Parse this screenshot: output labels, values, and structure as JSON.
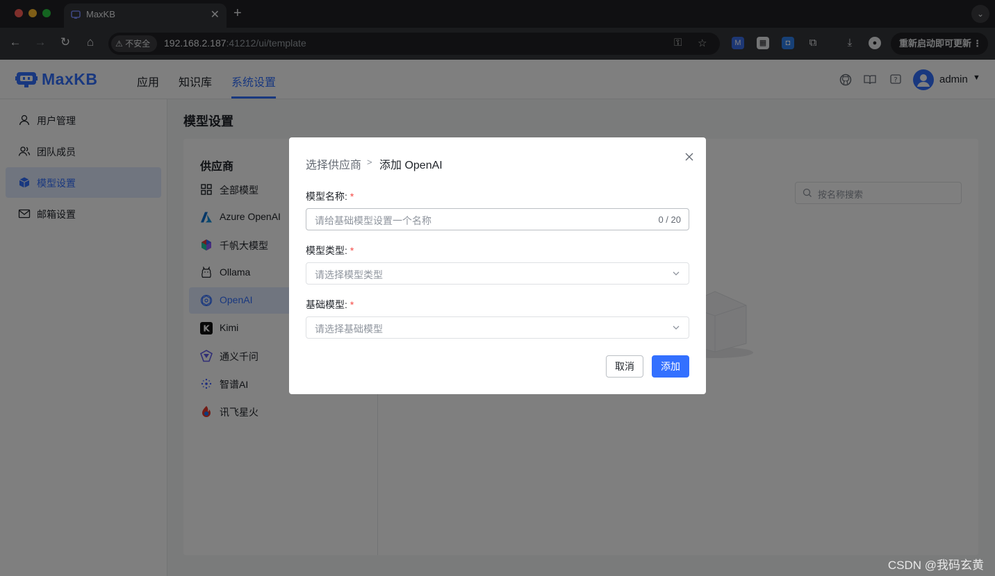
{
  "browser": {
    "tab_title": "MaxKB",
    "new_tab": "+",
    "insecure_label": "不安全",
    "url_host": "192.168.2.187",
    "url_rest": ":41212/ui/template",
    "update_label": "重新启动即可更新"
  },
  "app": {
    "logo_text": "MaxKB",
    "nav": [
      "应用",
      "知识库",
      "系统设置"
    ],
    "user": "admin"
  },
  "sidebar": {
    "items": [
      {
        "label": "用户管理",
        "icon": "user-icon"
      },
      {
        "label": "团队成员",
        "icon": "team-icon"
      },
      {
        "label": "模型设置",
        "icon": "cube-icon",
        "active": true
      },
      {
        "label": "邮箱设置",
        "icon": "mail-icon"
      }
    ]
  },
  "main": {
    "page_title": "模型设置",
    "provider_title": "供应商",
    "providers": [
      {
        "label": "全部模型",
        "icon": "grid-icon"
      },
      {
        "label": "Azure OpenAI",
        "icon": "azure-icon"
      },
      {
        "label": "千帆大模型",
        "icon": "qianfan-icon"
      },
      {
        "label": "Ollama",
        "icon": "ollama-icon"
      },
      {
        "label": "OpenAI",
        "icon": "openai-icon",
        "active": true
      },
      {
        "label": "Kimi",
        "icon": "kimi-icon"
      },
      {
        "label": "通义千问",
        "icon": "tongyi-icon"
      },
      {
        "label": "智谱AI",
        "icon": "zhipu-icon"
      },
      {
        "label": "讯飞星火",
        "icon": "xunfei-icon"
      }
    ],
    "search_placeholder": "按名称搜索"
  },
  "dialog": {
    "crumb_parent": "选择供应商",
    "crumb_sep": ">",
    "crumb_current": "添加 OpenAI",
    "name_label": "模型名称:",
    "name_placeholder": "请给基础模型设置一个名称",
    "name_count": "0 / 20",
    "type_label": "模型类型:",
    "type_placeholder": "请选择模型类型",
    "base_label": "基础模型:",
    "base_placeholder": "请选择基础模型",
    "required_mark": "*",
    "cancel_label": "取消",
    "add_label": "添加"
  },
  "colors": {
    "accent": "#3370ff",
    "required": "#f54a45"
  },
  "watermark": "CSDN @我码玄黄"
}
